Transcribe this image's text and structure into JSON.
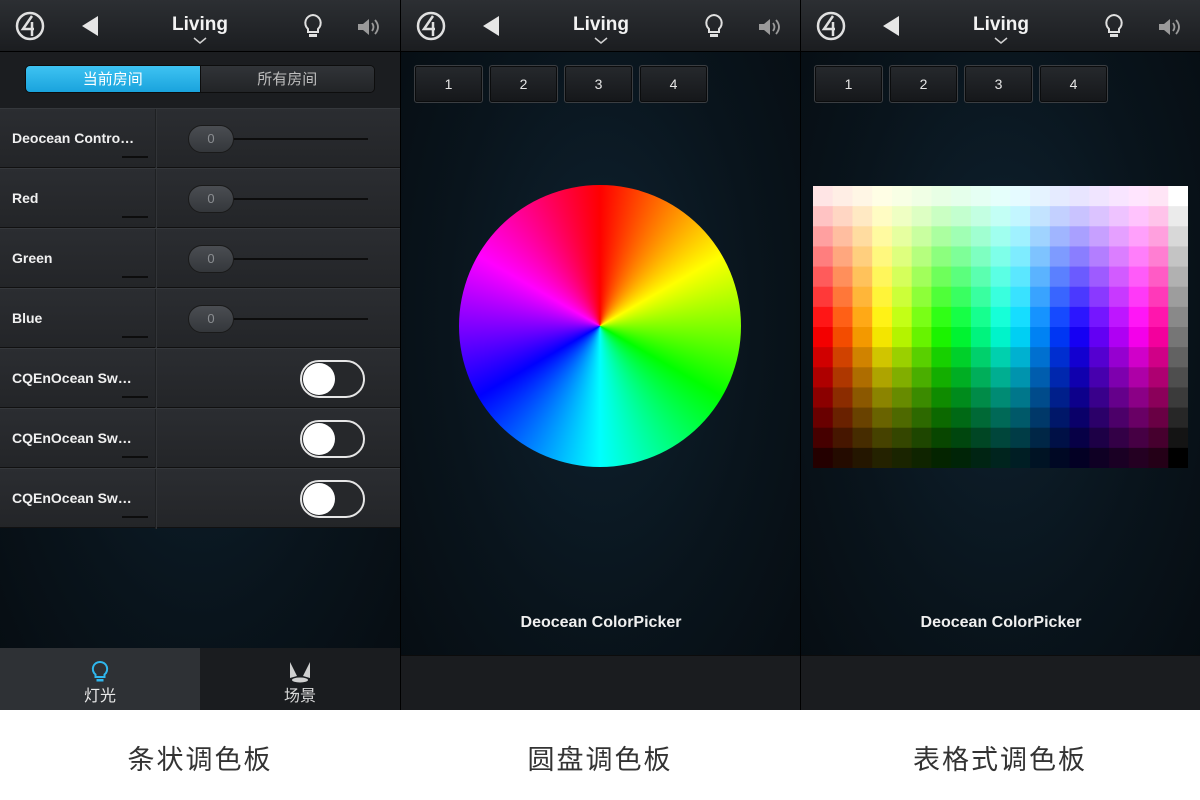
{
  "nav": {
    "title": "Living"
  },
  "panel1": {
    "segment": {
      "current": "当前房间",
      "all": "所有房间"
    },
    "rows": [
      {
        "label": "Deocean Contro…",
        "type": "slider",
        "value": "0"
      },
      {
        "label": "Red",
        "type": "slider",
        "value": "0"
      },
      {
        "label": "Green",
        "type": "slider",
        "value": "0"
      },
      {
        "label": "Blue",
        "type": "slider",
        "value": "0"
      },
      {
        "label": "CQEnOcean Sw…",
        "type": "toggle",
        "state": "off"
      },
      {
        "label": "CQEnOcean Sw…",
        "type": "toggle",
        "state": "off"
      },
      {
        "label": "CQEnOcean Sw…",
        "type": "toggle",
        "state": "off"
      }
    ],
    "tabs": {
      "light": "灯光",
      "scene": "场景"
    }
  },
  "panel2": {
    "buttons": [
      "1",
      "2",
      "3",
      "4"
    ],
    "picker_name": "Deocean ColorPicker"
  },
  "panel3": {
    "buttons": [
      "1",
      "2",
      "3",
      "4"
    ],
    "picker_name": "Deocean ColorPicker"
  },
  "captions": {
    "c1": "条状调色板",
    "c2": "圆盘调色板",
    "c3": "表格式调色板"
  },
  "colors": {
    "accent": "#1aa3dd",
    "text": "#f0f0f0"
  }
}
